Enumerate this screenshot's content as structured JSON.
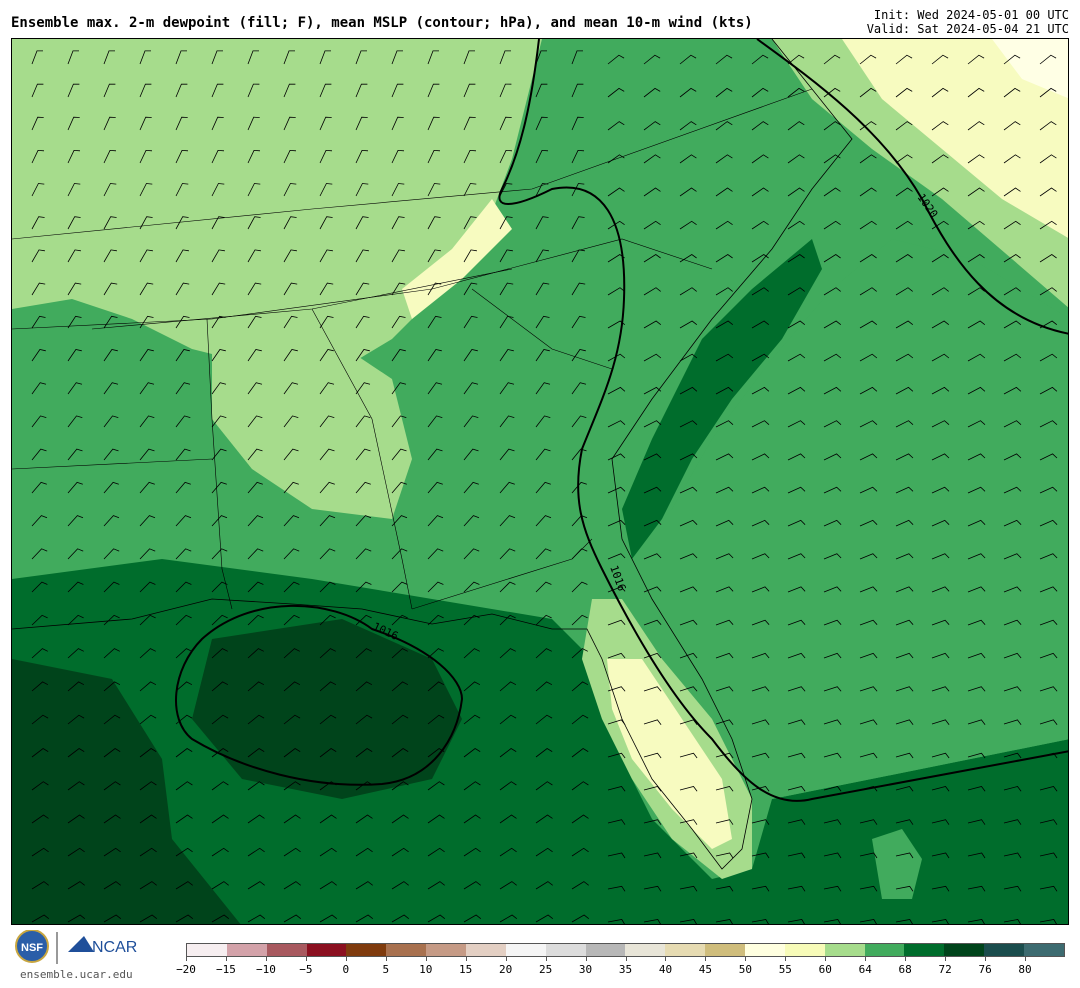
{
  "header": {
    "title": "Ensemble max. 2-m dewpoint (fill; F), mean MSLP (contour; hPa), and mean 10-m wind (kts)",
    "init": "Init: Wed 2024-05-01 00 UTC",
    "valid": "Valid: Sat 2024-05-04 21 UTC"
  },
  "map": {
    "contour_labels": [
      "1016",
      "1016",
      "1020"
    ],
    "colors": {
      "ocean_deep": "#00441b",
      "fill_72": "#006d2c",
      "fill_68": "#238b45",
      "fill_64": "#41ab5d",
      "fill_60": "#a6dc8c",
      "fill_55": "#f7fbc0",
      "fill_50": "#ffffe5"
    }
  },
  "footer": {
    "logo_nsf": "NSF",
    "logo_ncar": "NCAR",
    "site": "ensemble.ucar.edu"
  },
  "colorbar": {
    "colors": [
      "#f6eef0",
      "#d3a2a9",
      "#a8595f",
      "#8b1020",
      "#7f3b0d",
      "#a8714f",
      "#c59a85",
      "#e3cfc3",
      "#f5f5f5",
      "#dcdcdc",
      "#b7b7b7",
      "#e8e5d8",
      "#e6dbb2",
      "#cfbd7c",
      "#ffffe0",
      "#f7fbb8",
      "#a6dc8c",
      "#41ab5d",
      "#006d2c",
      "#00441b",
      "#1b4d4d",
      "#3d6b70"
    ],
    "ticks": [
      "−20",
      "−15",
      "−10",
      "−5",
      "0",
      "5",
      "10",
      "15",
      "20",
      "25",
      "30",
      "35",
      "40",
      "45",
      "50",
      "55",
      "60",
      "64",
      "68",
      "72",
      "76",
      "80"
    ]
  }
}
